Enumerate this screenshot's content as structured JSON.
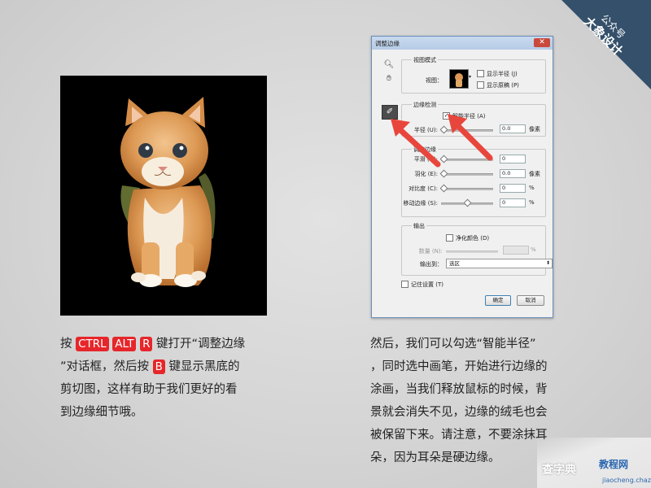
{
  "corner_badge": {
    "line1": "公众号",
    "line2": "大象设计",
    "bg_color": "#34506a"
  },
  "left_caption": {
    "pre1": "按 ",
    "key1": "CTRL",
    "key2": "ALT",
    "key3": "R",
    "mid1": " 键打开“调整边缘",
    "mid2": "”对话框，然后按 ",
    "key4": "B",
    "mid3": " 键显示黑底的",
    "line3": "剪切图，这样有助于我们更好的看",
    "line4": "到边缘细节哦。",
    "key_color": "#e6262a"
  },
  "right_caption": {
    "lines": [
      "然后，我们可以勾选“智能半径”",
      "，同时选中画笔，开始进行边缘的",
      "涂画，当我们释放鼠标的时候，背",
      "景就会消失不见，边缘的绒毛也会",
      "被保留下来。请注意，不要涂抹耳",
      "朵，因为耳朵是硬边缘。"
    ]
  },
  "dialog": {
    "title": "调整边缘",
    "close": "✕",
    "tools": [
      "magnifier-icon",
      "hand-icon"
    ],
    "view_mode": {
      "label": "视图模式",
      "view_label": "视图：",
      "show_radius": "显示半径 (J)",
      "show_original": "显示原稿 (P)"
    },
    "edge_detection": {
      "label": "边缘检测",
      "smart_radius": "智能半径 (A)",
      "radius_label": "半径 (U):",
      "radius_value": "0.0",
      "radius_unit": "像素"
    },
    "adjust_edge": {
      "label": "调整边缘",
      "rows": [
        {
          "label": "平滑 (H):",
          "value": "0",
          "unit": "",
          "pos": 0
        },
        {
          "label": "羽化 (E):",
          "value": "0.0",
          "unit": "像素",
          "pos": 0
        },
        {
          "label": "对比度 (C):",
          "value": "0",
          "unit": "%",
          "pos": 0
        },
        {
          "label": "移动边缘 (S):",
          "value": "0",
          "unit": "%",
          "pos": 0.5
        }
      ]
    },
    "output": {
      "label": "输出",
      "decontaminate": "净化颜色 (D)",
      "amount_label": "数量 (N):",
      "amount_unit": "%",
      "output_to_label": "输出到：",
      "output_to_value": "选区"
    },
    "remember": "记住设置 (T)",
    "ok": "确定",
    "cancel": "取消",
    "arrow_color": "#e8463c"
  },
  "watermark": {
    "site1": "查字典",
    "site2": "教程网",
    "url": "jiaocheng.chazidian.com"
  }
}
